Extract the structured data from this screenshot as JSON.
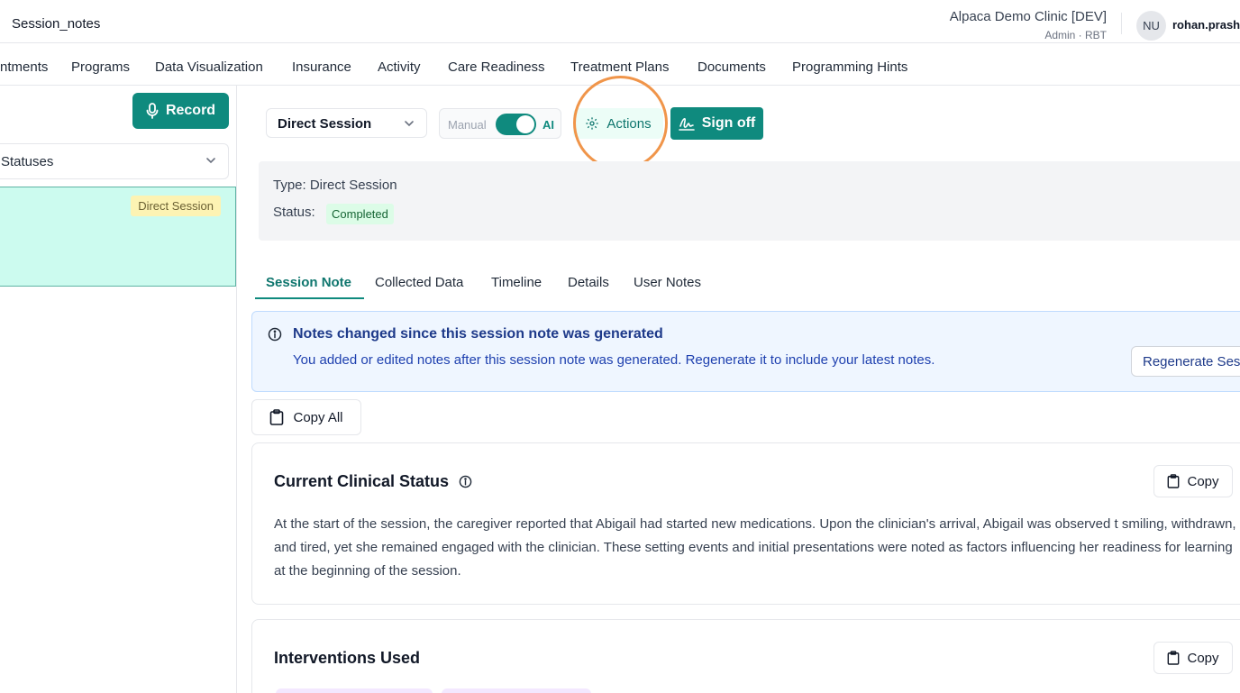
{
  "header": {
    "app_title": "Session_notes",
    "clinic_name": "Alpaca Demo Clinic [DEV]",
    "clinic_role": "Admin · RBT",
    "avatar_initials": "NU",
    "username": "rohan.prash"
  },
  "nav": {
    "items": [
      "ntments",
      "Programs",
      "Data Visualization",
      "Insurance",
      "Activity",
      "Care Readiness",
      "Treatment Plans",
      "Documents",
      "Programming Hints"
    ]
  },
  "sidebar": {
    "record_label": "Record",
    "status_filter": "Statuses",
    "card_badge": "Direct Session"
  },
  "toolbar": {
    "session_type": "Direct Session",
    "mode_manual": "Manual",
    "mode_ai": "AI",
    "actions_label": "Actions",
    "signoff_label": "Sign off"
  },
  "info": {
    "type_line": "Type: Direct Session",
    "status_label": "Status:",
    "status_value": "Completed"
  },
  "tabs": [
    "Session Note",
    "Collected Data",
    "Timeline",
    "Details",
    "User Notes"
  ],
  "alert": {
    "title": "Notes changed since this session note was generated",
    "body": "You added or edited notes after this session note was generated. Regenerate it to include your latest notes.",
    "button": "Regenerate Ses"
  },
  "copy_all_label": "Copy All",
  "cards": {
    "clinical_title": "Current Clinical Status",
    "clinical_text": "At the start of the session, the caregiver reported that Abigail had started new medications. Upon the clinician's arrival, Abigail was observed t smiling, withdrawn, and tired, yet she remained engaged with the clinician. These setting events and initial presentations were noted as factors influencing her readiness for learning at the beginning of the session.",
    "interventions_title": "Interventions Used",
    "copy_label": "Copy"
  },
  "colors": {
    "primary": "#0f8a7e",
    "highlight_ring": "#f0954a",
    "card_selected": "#ccfbef",
    "alert_bg": "#eff6ff"
  }
}
